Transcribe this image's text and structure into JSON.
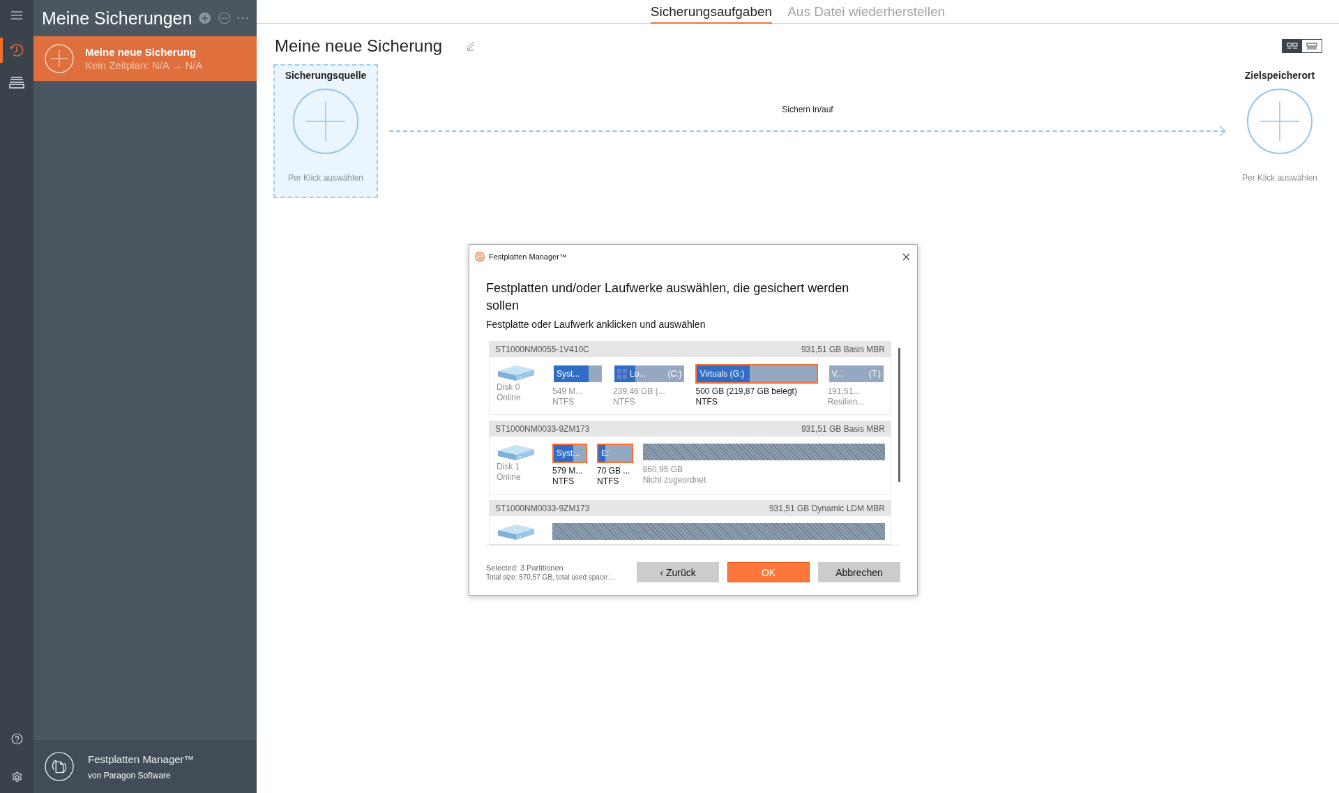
{
  "rail": [
    {
      "kind": "history",
      "selected": true
    },
    {
      "kind": "drives",
      "selected": false
    }
  ],
  "sidebar": {
    "title": "Meine Sicherungen",
    "tasks": [
      {
        "name": "Meine neue Sicherung",
        "schedule": "Kein Zeitplan: N/A → N/A",
        "selected": true
      }
    ],
    "footer": {
      "product": "Festplatten Manager™",
      "vendor": "von Paragon Software"
    }
  },
  "tabs": [
    {
      "label": "Sicherungsaufgaben",
      "selected": true
    },
    {
      "label": "Aus Datei wiederherstellen",
      "selected": false
    }
  ],
  "task_title": "Meine neue Sicherung",
  "view_modes": [
    {
      "kind": "tiles",
      "selected": true
    },
    {
      "kind": "list",
      "selected": false
    }
  ],
  "source": {
    "title": "Sicherungsquelle",
    "hint": "Per Klick auswählen"
  },
  "link_label": "Sichern in/auf",
  "destination": {
    "title": "Zielspeicherort",
    "hint": "Per Klick auswählen"
  },
  "dialog": {
    "title": "Festplatten Manager™",
    "heading": "Festplatten und/oder Laufwerke auswählen, die gesichert werden sollen",
    "subheading": "Festplatte oder Laufwerk anklicken und auswählen",
    "disks": [
      {
        "model": "ST1000NM0055-1V410C",
        "info": "931,51 GB Basis MBR",
        "name": "Disk 0",
        "status": "Online",
        "partitions": [
          {
            "kind": "partition",
            "label": "Syst...",
            "level": 0.72,
            "selected": false,
            "size": "549 M...",
            "fs": "NTFS"
          },
          {
            "kind": "os-partition",
            "label": "Lo...",
            "drive": "(C:)",
            "level": 0.3,
            "selected": false,
            "size": "239,46 GB (...",
            "fs": "NTFS"
          },
          {
            "kind": "partition",
            "label": "Virtuals (G:)",
            "level": 0.44,
            "selected": true,
            "size": "500 GB (219,87 GB belegt)",
            "fs": "NTFS"
          },
          {
            "kind": "partition",
            "label": "V...",
            "drive": "(T:)",
            "selected": false,
            "size": "191,51...",
            "fs": "Resilien..."
          }
        ]
      },
      {
        "model": "ST1000NM0033-9ZM173",
        "info": "931,51 GB Basis MBR",
        "name": "Disk 1",
        "status": "Online",
        "partitions": [
          {
            "kind": "partition",
            "label": "Syst...",
            "level": 0.6,
            "selected": true,
            "size": "579 M...",
            "fs": "NTFS"
          },
          {
            "kind": "partition",
            "label": "E:",
            "level": 0.2,
            "selected": true,
            "size": "70 GB ...",
            "fs": "NTFS"
          },
          {
            "kind": "unallocated",
            "size": "860,95 GB",
            "note": "Nicht zugeordnet"
          }
        ]
      },
      {
        "model": "ST1000NM0033-9ZM173",
        "info": "931,51 GB Dynamic LDM MBR",
        "partitions": [
          {
            "kind": "unallocated"
          }
        ]
      }
    ],
    "summary": [
      "Selected: 3 Partitionen",
      "Total size: 570,57 GB, total used space:..."
    ],
    "buttons": [
      {
        "label": "‹ Zurück",
        "kind": "secondary"
      },
      {
        "label": "OK",
        "kind": "primary"
      },
      {
        "label": "Abbrechen",
        "kind": "secondary"
      }
    ]
  }
}
